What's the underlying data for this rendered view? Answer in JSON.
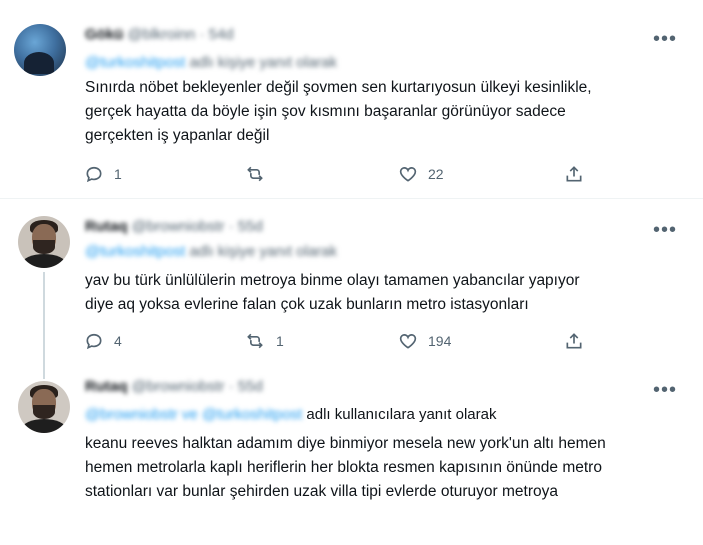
{
  "tweets": [
    {
      "author_name": "Gökü",
      "author_handle": "@blkroinn",
      "time": "· 54d",
      "reply_to_mentions": "@turkoshitpost",
      "reply_to_suffix": "adlı kişiye yanıt olarak",
      "reply_to_suffix_blurred": true,
      "text_lines": [
        "Sınırda nöbet bekleyenler değil şovmen sen kurtarıyosun ülkeyi kesinlikle,",
        "gerçek hayatta da böyle işin şov kısmını başaranlar görünüyor sadece",
        "gerçekten iş yapanlar değil"
      ],
      "actions": {
        "reply": "1",
        "retweet": "",
        "like": "22"
      }
    },
    {
      "author_name": "Rutaq",
      "author_handle": "@browniobstr",
      "time": "· 55d",
      "reply_to_mentions": "@turkoshitpost",
      "reply_to_suffix": "adlı kişiye yanıt olarak",
      "reply_to_suffix_blurred": true,
      "text_lines": [
        "yav bu türk ünlülülerin metroya binme olayı tamamen yabancılar yapıyor",
        "diye aq yoksa evlerine falan çok uzak bunların metro istasyonları"
      ],
      "actions": {
        "reply": "4",
        "retweet": "1",
        "like": "194"
      }
    },
    {
      "author_name": "Rutaq",
      "author_handle": "@browniobstr",
      "time": "· 55d",
      "reply_to_mentions": "@browniobstr ve @turkoshitpost",
      "reply_to_suffix": "adlı kullanıcılara yanıt olarak",
      "reply_to_suffix_blurred": false,
      "text_lines": [
        "keanu reeves halktan adamım diye binmiyor mesela new york'un altı hemen",
        "hemen metrolarla kaplı heriflerin her blokta resmen kapısının önünde metro",
        "stationları var bunlar şehirden uzak villa tipi evlerde oturuyor metroya"
      ],
      "actions": null
    }
  ],
  "icons": {
    "more": "more-dots-icon",
    "reply": "reply-bubble-icon",
    "retweet": "retweet-icon",
    "like": "heart-icon",
    "share": "share-upload-icon"
  },
  "colors": {
    "text": "#0f1419",
    "secondary": "#536471",
    "mention": "#1d9bf0",
    "divider": "#eff3f4",
    "thread_line": "#cfd9de"
  }
}
